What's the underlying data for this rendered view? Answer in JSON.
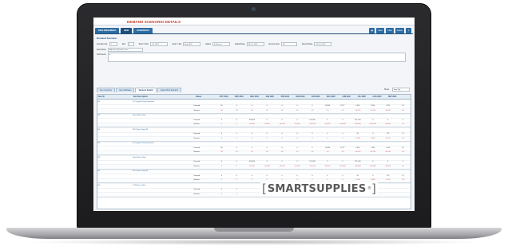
{
  "app": {
    "title": "DEMAND SCENARIO DETAILS"
  },
  "tabs": [
    {
      "label": "REPLENISHMENT",
      "active": false
    },
    {
      "label": "NEW",
      "active": true
    },
    {
      "label": "SCENARIOS",
      "active": false
    }
  ],
  "actions": [
    {
      "label": "▣",
      "icon": "save-icon"
    },
    {
      "label": "Save"
    },
    {
      "label": "Clear"
    },
    {
      "label": "Delete"
    },
    {
      "label": "▾",
      "icon": "menu-icon"
    }
  ],
  "section_title": "Demand Scenario",
  "form": {
    "scenario_no": {
      "label": "Scenario No.",
      "value": "1"
    },
    "rev": {
      "label": "Rev.",
      "value": "0"
    },
    "start": {
      "label": "Start Yr-Mo",
      "value": "Oct 2019"
    },
    "end": {
      "label": "End Yr-Mo",
      "value": "Aug 2020"
    },
    "status": {
      "label": "Status",
      "value": "In Review"
    },
    "added_date": {
      "label": "Added Date",
      "value": "28 Oct 2019"
    },
    "record_user": {
      "label": "Record User",
      "value": "JB"
    },
    "record_date": {
      "label": "Record Date",
      "value": "29 Oct 2019"
    },
    "description": {
      "label": "Description",
      "value": "Adjusted Q3 peak 1 test"
    },
    "comments": {
      "label": "Comments",
      "value": "S"
    }
  },
  "subtabs": [
    {
      "label": "Item Inventory",
      "active": false
    },
    {
      "label": "Item Attributes",
      "active": false
    },
    {
      "label": "Variance Details",
      "active": true
    },
    {
      "label": "Adjust Prod Demand",
      "active": false
    }
  ],
  "view": {
    "label": "Show",
    "value": "Item Qty"
  },
  "grid": {
    "headers": [
      "Item ID",
      "Item Description",
      "Values",
      "OCT 2019",
      "NOV 2019",
      "DEC 2019",
      "JAN 2020",
      "FEB 2020",
      "MAR 2020",
      "APR 2020",
      "MAY 2020",
      "JUN 2020",
      "JUL 2020",
      "AUG 2020",
      "SEP 2020"
    ],
    "items": [
      {
        "id": "101",
        "desc": "DC Pyrgium Pong Detections",
        "rows": [
          {
            "type": "Demand",
            "vals": [
              "35",
              "0",
              "0",
              "0",
              "0",
              "0",
              "0",
              "11,980",
              "8,777",
              "1,620",
              "2,900",
              "1,720",
              "3,1"
            ]
          },
          {
            "type": "Variance",
            "vals": [
              "-30",
              "-25",
              "-10",
              "-20",
              "-30",
              "-10",
              "-20",
              "-10",
              "-20",
              "-14,020",
              "-10,100",
              "-30,190",
              "-4,0"
            ]
          }
        ]
      },
      {
        "id": "201",
        "desc": "Kobe Whey Tablet",
        "rows": [
          {
            "type": "Demand",
            "vals": [
              "0",
              "0",
              "100,000",
              "0",
              "0",
              "0",
              "174,450",
              "0",
              "0",
              "151,100",
              "0",
              "0",
              "0"
            ]
          },
          {
            "type": "Variance",
            "vals": [
              "0",
              "0",
              "-10,000",
              "-10,000",
              "-40,000",
              "-50,000",
              "-120,000",
              "-40,000",
              "-120,000",
              "-240,000",
              "-160,000",
              "-40,000",
              "-10,"
            ]
          }
        ]
      },
      {
        "id": "301",
        "desc": "MC3 Pylon 10mg/TR",
        "rows": [
          {
            "type": "Demand",
            "vals": [
              "0",
              "0",
              "0",
              "0",
              "0",
              "0",
              "0",
              "0",
              "0",
              "50",
              "0",
              "770",
              "1,1"
            ]
          },
          {
            "type": "Variance",
            "vals": [
              "0",
              "0",
              "0",
              "0",
              "0",
              "0",
              "0",
              "0",
              "0",
              "-2,000",
              "-1,800",
              "-1,100",
              "-1,6"
            ]
          }
        ]
      },
      {
        "id": "101",
        "desc": "DC Pyrgium Pong Detections",
        "rows": [
          {
            "type": "Demand",
            "vals": [
              "35",
              "0",
              "0",
              "0",
              "0",
              "0",
              "0",
              "11,980",
              "8,777",
              "1,620",
              "2,900",
              "1,720",
              "3,1"
            ]
          },
          {
            "type": "Variance",
            "vals": [
              "-30",
              "-25",
              "-10",
              "-20",
              "-30",
              "-10",
              "-20",
              "-10",
              "-20",
              "-14,020",
              "-10,100",
              "-30,190",
              "-4,0"
            ]
          }
        ]
      },
      {
        "id": "201",
        "desc": "Kobe Whey Tablet",
        "rows": [
          {
            "type": "Demand",
            "vals": [
              "0",
              "0",
              "100,000",
              "0",
              "0",
              "0",
              "174,450",
              "0",
              "0",
              "151,100",
              "0",
              "0",
              "0"
            ]
          },
          {
            "type": "Variance",
            "vals": [
              "0",
              "0",
              "-10,000",
              "-10,000",
              "-40,000",
              "-50,000",
              "-120,000",
              "-40,000",
              "-120,000",
              "-240,000",
              "-160,000",
              "-40,000",
              "-10,"
            ]
          }
        ]
      },
      {
        "id": "301",
        "desc": "MC3 Pylon 10mg/TR",
        "rows": [
          {
            "type": "Demand",
            "vals": [
              "0",
              "0",
              "0",
              "0",
              "0",
              "0",
              "0",
              "0",
              "0",
              "50",
              "0",
              "770",
              "1,1"
            ]
          },
          {
            "type": "Variance",
            "vals": [
              "0",
              "0",
              "0",
              "0",
              "0",
              "0",
              "0",
              "0",
              "0",
              "-2,000",
              "-1,800",
              "-1,100",
              "-1,6"
            ]
          }
        ]
      },
      {
        "id": "401",
        "desc": "PYM Amey Tablet",
        "rows": [
          {
            "type": "Demand",
            "vals": [
              "0",
              "0",
              "",
              "",
              "",
              "",
              "",
              "",
              "",
              "",
              "",
              "",
              ""
            ]
          },
          {
            "type": "Variance",
            "vals": [
              "0",
              "0",
              "",
              "",
              "",
              "",
              "",
              "",
              "",
              "",
              "",
              "",
              ""
            ]
          }
        ]
      }
    ]
  },
  "logo": {
    "text": "SMARTSUPPLIES",
    "open": "[",
    "close": "]",
    "mark": "®"
  },
  "colors": {
    "primary": "#2d6da3",
    "title_red": "#c0392b",
    "variance_red": "#d9534f"
  }
}
